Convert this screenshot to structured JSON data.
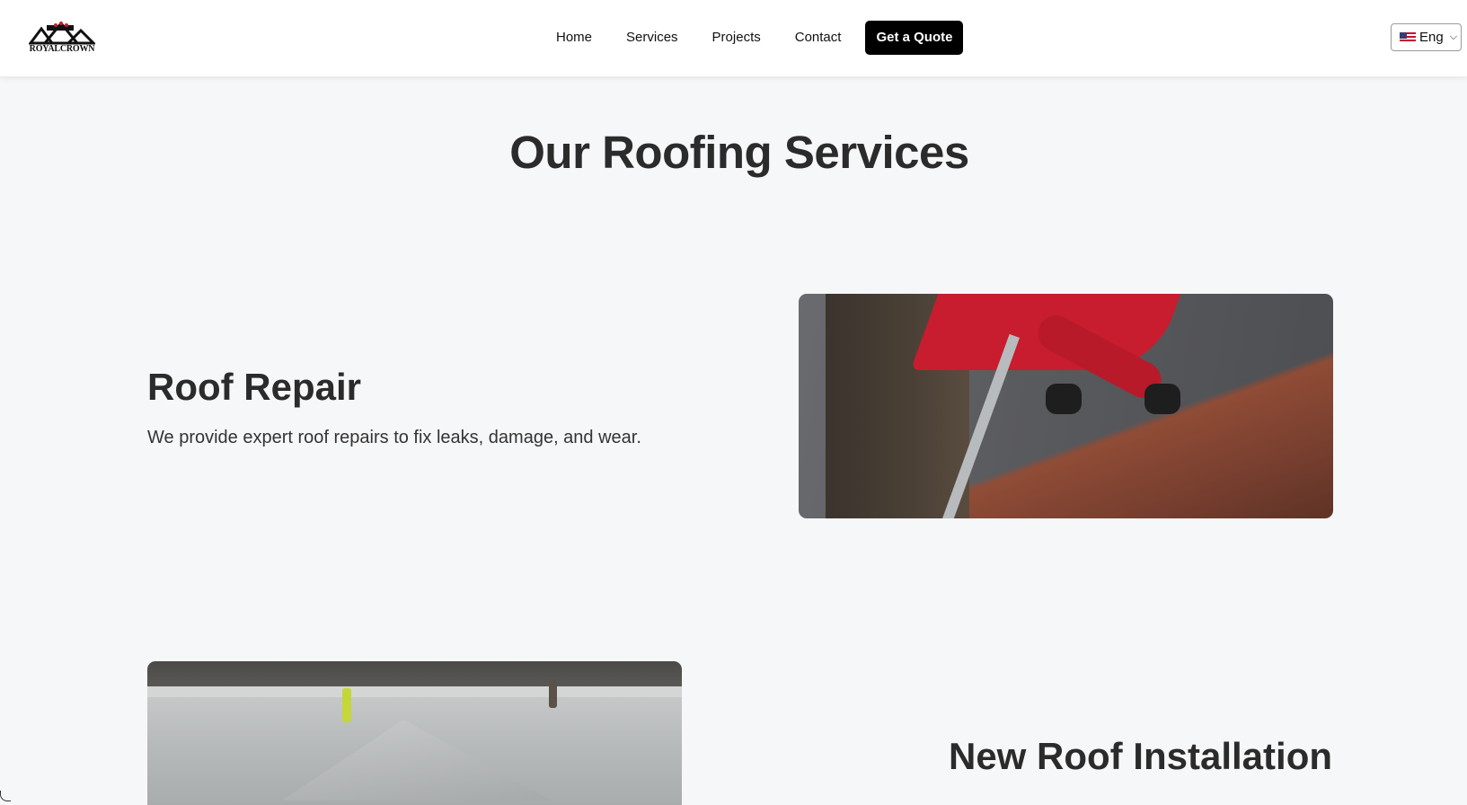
{
  "nav": {
    "logo_text": "ROYALCROWN",
    "links": [
      "Home",
      "Services",
      "Projects",
      "Contact"
    ],
    "quote_button": "Get a Quote",
    "language": "Eng"
  },
  "page": {
    "title": "Our Roofing Services"
  },
  "services": [
    {
      "title": "Roof Repair",
      "description": "We provide expert roof repairs to fix leaks, damage, and wear."
    },
    {
      "title": "New Roof Installation"
    }
  ]
}
